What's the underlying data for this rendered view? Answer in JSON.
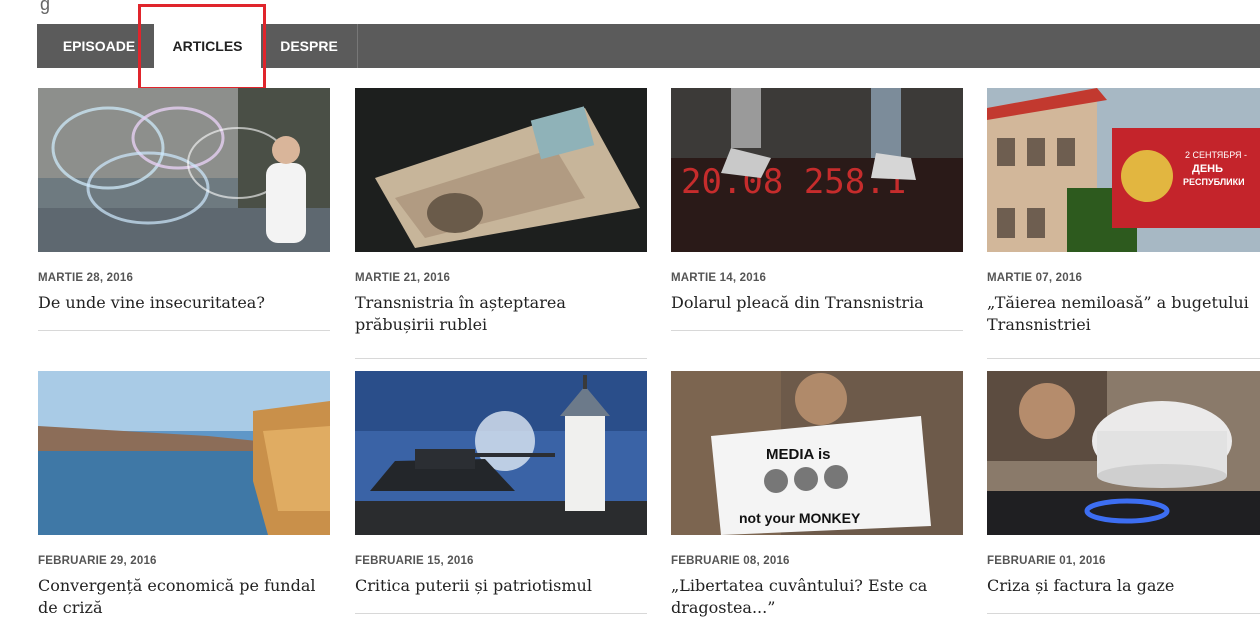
{
  "nav": {
    "tabs": [
      {
        "label": "EPISOADE"
      },
      {
        "label": "ARTICLES"
      },
      {
        "label": "DESPRE"
      }
    ]
  },
  "articles": [
    {
      "date": "MARTIE 28, 2016",
      "title": "De unde vine insecuritatea?"
    },
    {
      "date": "MARTIE 21, 2016",
      "title": "Transnistria în așteptarea prăbușirii rublei"
    },
    {
      "date": "MARTIE 14, 2016",
      "title": "Dolarul pleacă din Transnistria"
    },
    {
      "date": "MARTIE 07, 2016",
      "title": "„Tăierea nemiloasă” a bugetului Transnistriei"
    },
    {
      "date": "FEBRUARIE 29, 2016",
      "title": "Convergență economică pe fundal de criză"
    },
    {
      "date": "FEBRUARIE 15, 2016",
      "title": "Critica puterii și patriotismul"
    },
    {
      "date": "FEBRUARIE 08, 2016",
      "title": "„Libertatea cuvântului? Este ca dragostea...”"
    },
    {
      "date": "FEBRUARIE 01, 2016",
      "title": "Criza și factura la gaze"
    }
  ],
  "images": {
    "sign_text_1": "2 СЕНТЯБРЯ -",
    "sign_text_2": "ДЕНЬ",
    "sign_text_3": "РЕСПУБЛИКИ",
    "poster_text_1": "MEDIA is",
    "poster_text_2": "not your MONKEY",
    "ticker_text": "20.08 258.1"
  },
  "colors": {
    "nav_bg": "#5b5b5b",
    "highlight": "#e0252c"
  }
}
